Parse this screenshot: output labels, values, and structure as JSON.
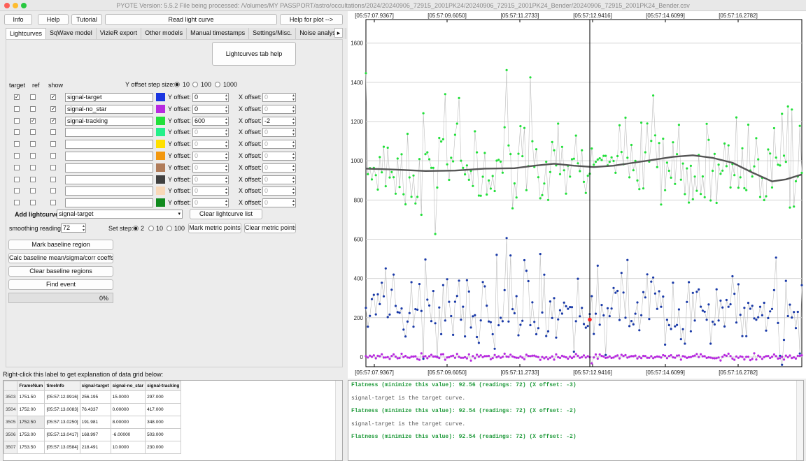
{
  "window": {
    "title": "PYOTE Version: 5.5.2  File being processed: /Volumes/MY PASSPORT/astro/occultations/2024/20240906_72915_2001PK24/20240906_72915_2001PK24_Bender/20240906_72915_2001PK24_Bender.csv"
  },
  "toolbar": {
    "info": "Info",
    "help": "Help",
    "tutorial": "Tutorial",
    "read": "Read light curve",
    "help_plot": "Help for plot -->"
  },
  "tabs": [
    "Lightcurves",
    "SqWave model",
    "VizieR export",
    "Other models",
    "Manual timestamps",
    "Settings/Misc.",
    "Noise analysis/"
  ],
  "tab_scroll": "▸",
  "panel": {
    "help_btn": "Lightcurves tab help",
    "col_target": "target",
    "col_ref": "ref",
    "col_show": "show",
    "yoffset_step_label": "Y offset step size:",
    "yoffset_steps": [
      "10",
      "100",
      "1000"
    ],
    "yoffset_label": "Y offset:",
    "xoffset_label": "X offset:",
    "rows": [
      {
        "target": true,
        "ref": false,
        "show": true,
        "name": "signal-target",
        "color": "#1a35e0",
        "y": "0",
        "x": "0",
        "enabled": true,
        "xenabled": false
      },
      {
        "target": false,
        "ref": false,
        "show": true,
        "name": "signal-no_star",
        "color": "#b82ae0",
        "y": "0",
        "x": "0",
        "enabled": true,
        "xenabled": false
      },
      {
        "target": false,
        "ref": true,
        "show": true,
        "name": "signal-tracking",
        "color": "#22e03a",
        "y": "600",
        "x": "-2",
        "enabled": true,
        "xenabled": true
      },
      {
        "target": false,
        "ref": false,
        "show": false,
        "name": "",
        "color": "#24f08a",
        "y": "0",
        "x": "0",
        "enabled": false,
        "xenabled": false
      },
      {
        "target": false,
        "ref": false,
        "show": false,
        "name": "",
        "color": "#ffe000",
        "y": "0",
        "x": "0",
        "enabled": false,
        "xenabled": false
      },
      {
        "target": false,
        "ref": false,
        "show": false,
        "name": "",
        "color": "#f3980f",
        "y": "0",
        "x": "0",
        "enabled": false,
        "xenabled": false
      },
      {
        "target": false,
        "ref": false,
        "show": false,
        "name": "",
        "color": "#b07c5a",
        "y": "0",
        "x": "0",
        "enabled": false,
        "xenabled": false
      },
      {
        "target": false,
        "ref": false,
        "show": false,
        "name": "",
        "color": "#404040",
        "y": "0",
        "x": "0",
        "enabled": false,
        "xenabled": false
      },
      {
        "target": false,
        "ref": false,
        "show": false,
        "name": "",
        "color": "#f8d8b8",
        "y": "0",
        "x": "0",
        "enabled": false,
        "xenabled": false
      },
      {
        "target": false,
        "ref": false,
        "show": false,
        "name": "",
        "color": "#108a1e",
        "y": "0",
        "x": "0",
        "enabled": false,
        "xenabled": false
      }
    ],
    "add_lc_label": "Add lightcurve",
    "add_lc_value": "signal-target",
    "clear_lc_btn": "Clear lightcurve list",
    "smoothing_label": "smoothing readings",
    "smoothing_value": "72",
    "set_step_label": "Set step:",
    "set_steps": [
      "2",
      "10",
      "100"
    ],
    "mark_metric_btn": "Mark metric points",
    "clear_metric_btn": "Clear metric points",
    "mark_baseline_btn": "Mark baseline region",
    "calc_baseline_btn": "Calc baseline mean/sigma/corr coeffs",
    "clear_baseline_btn": "Clear baseline regions",
    "find_event_btn": "Find event",
    "progress": 0,
    "progress_text": "0%"
  },
  "grid": {
    "label": "Right-click this label to get explanation of data grid below:",
    "headers": [
      "FrameNum",
      "timeInfo",
      "signal-target",
      "signal-no_star",
      "signal-tracking"
    ],
    "rows": [
      {
        "rn": "3503",
        "cells": [
          "1751.50",
          "[05:57:12.9916]",
          "256.195",
          "15.0000",
          "297.000"
        ]
      },
      {
        "rn": "3504",
        "cells": [
          "1752.00",
          "[05:57:13.0083]",
          "76.4337",
          "0.00000",
          "417.000"
        ]
      },
      {
        "rn": "3505",
        "cells": [
          "1752.50",
          "[05:57:13.0250]",
          "191.981",
          "8.00000",
          "348.000"
        ]
      },
      {
        "rn": "3506",
        "cells": [
          "1753.00",
          "[05:57:13.0417]",
          "168.997",
          "-6.00000",
          "503.000"
        ]
      },
      {
        "rn": "3507",
        "cells": [
          "1753.50",
          "[05:57:13.0584]",
          "218.491",
          "10.0000",
          "230.000"
        ]
      }
    ]
  },
  "console": {
    "lines": [
      {
        "text": "Flatness (minimize this value): 92.56 (readings: 72) (X offset: -3)",
        "style": "green"
      },
      {
        "text": "signal-target is the target curve.",
        "style": "grey"
      },
      {
        "text": "Flatness (minimize this value): 92.54 (readings: 72) (X offset: -2)",
        "style": "green"
      },
      {
        "text": "signal-target is the target curve.",
        "style": "grey"
      },
      {
        "text": "Flatness (minimize this value): 92.54 (readings: 72) (X offset: -2)",
        "style": "green"
      }
    ]
  },
  "chart_data": {
    "type": "scatter",
    "x_ticks": [
      "05:57:07.9367",
      "05:57:09.6050",
      "05:57:11.2733",
      "05:57:12.9416",
      "05:57:14.6099",
      "05:57:16.2782"
    ],
    "y_ticks": [
      0,
      200,
      400,
      600,
      800,
      1000,
      1200,
      1400,
      1600
    ],
    "ylim": [
      -50,
      1720
    ],
    "xlim": [
      0,
      220
    ],
    "cursor_x": 113,
    "marked_point": {
      "x": 113,
      "y": 190
    },
    "series": [
      {
        "name": "signal-tracking",
        "color": "#22e03a",
        "mean": 960,
        "sd": 125,
        "shift": 600
      },
      {
        "name": "smoothed",
        "color": "#555555",
        "points": [
          [
            0,
            960
          ],
          [
            15,
            955
          ],
          [
            30,
            948
          ],
          [
            45,
            950
          ],
          [
            60,
            960
          ],
          [
            75,
            962
          ],
          [
            85,
            975
          ],
          [
            95,
            985
          ],
          [
            105,
            975
          ],
          [
            115,
            968
          ],
          [
            125,
            975
          ],
          [
            135,
            990
          ],
          [
            145,
            1005
          ],
          [
            155,
            1020
          ],
          [
            165,
            1028
          ],
          [
            175,
            1015
          ],
          [
            185,
            990
          ],
          [
            195,
            940
          ],
          [
            205,
            895
          ],
          [
            212,
            905
          ],
          [
            220,
            930
          ]
        ]
      },
      {
        "name": "signal-target",
        "color": "#1a3aa8",
        "mean": 225,
        "sd": 95
      },
      {
        "name": "signal-no_star",
        "color": "#b82ae0",
        "mean": 0,
        "sd": 8
      }
    ]
  }
}
